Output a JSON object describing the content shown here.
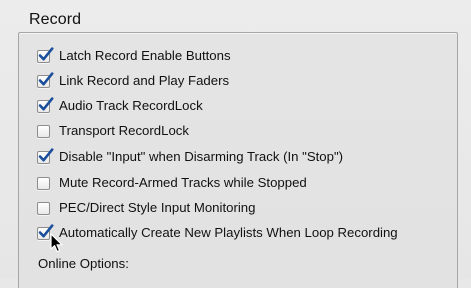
{
  "section": {
    "title": "Record"
  },
  "options": [
    {
      "label": "Latch Record Enable Buttons",
      "checked": true
    },
    {
      "label": "Link Record and Play Faders",
      "checked": true
    },
    {
      "label": "Audio Track RecordLock",
      "checked": true
    },
    {
      "label": "Transport RecordLock",
      "checked": false
    },
    {
      "label": "Disable \"Input\" when Disarming Track (In \"Stop\")",
      "checked": true
    },
    {
      "label": "Mute Record-Armed Tracks while Stopped",
      "checked": false
    },
    {
      "label": "PEC/Direct Style Input Monitoring",
      "checked": false
    },
    {
      "label": "Automatically Create New Playlists When Loop Recording",
      "checked": true
    }
  ],
  "online_options": {
    "label": "Online Options:"
  },
  "colors": {
    "check_mark": "#1b4f9c",
    "text": "#111111",
    "panel_bg": "#e6e6e6",
    "box_border": "#a6a6a6"
  },
  "icons": {
    "check": "check-icon",
    "cursor": "mouse-pointer-icon"
  }
}
